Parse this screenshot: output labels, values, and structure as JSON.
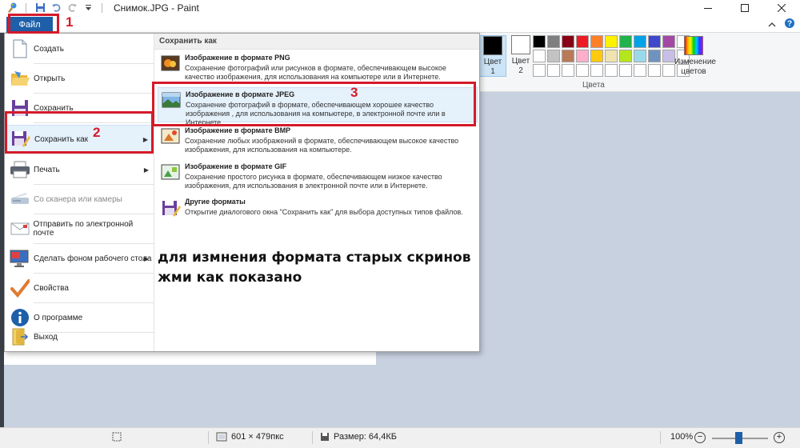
{
  "window": {
    "title": "Снимок.JPG - Paint"
  },
  "ribbon": {
    "file_tab_label": "Файл",
    "color1_label": "Цвет 1",
    "color2_label": "Цвет 2",
    "edit_colors_label": "Изменение цветов",
    "colors_group_label": "Цвета",
    "palette": [
      "#000000",
      "#7f7f7f",
      "#880015",
      "#ed1c24",
      "#ff7f27",
      "#fff200",
      "#22b14c",
      "#00a2e8",
      "#3f48cc",
      "#a349a4",
      "#ffffff",
      "#ffffff",
      "#c3c3c3",
      "#b97a57",
      "#ffaec9",
      "#ffc90e",
      "#efe4b0",
      "#b5e61d",
      "#99d9ea",
      "#7092be",
      "#c8bfe7",
      "#ffffff",
      "#ffffff",
      "#ffffff",
      "#ffffff",
      "#ffffff",
      "#ffffff",
      "#ffffff",
      "#ffffff",
      "#ffffff",
      "#ffffff",
      "#ffffff",
      "#ffffff"
    ],
    "color1_value": "#000000",
    "color2_value": "#ffffff"
  },
  "file_menu": {
    "items": [
      {
        "label": "Создать",
        "icon": "new-file-icon"
      },
      {
        "label": "Открыть",
        "icon": "open-folder-icon"
      },
      {
        "label": "Сохранить",
        "icon": "save-icon"
      },
      {
        "label": "Сохранить как",
        "icon": "save-as-icon",
        "has_submenu": true,
        "selected": true
      },
      {
        "label": "Печать",
        "icon": "printer-icon",
        "has_submenu": true
      },
      {
        "label": "Со сканера или камеры",
        "icon": "scanner-icon",
        "disabled": true
      },
      {
        "label": "Отправить по электронной почте",
        "icon": "email-icon"
      },
      {
        "label": "Сделать фоном рабочего стола",
        "icon": "desktop-background-icon",
        "has_submenu": true
      },
      {
        "label": "Свойства",
        "icon": "checkmark-icon"
      },
      {
        "label": "О программе",
        "icon": "info-icon"
      },
      {
        "label": "Выход",
        "icon": "exit-icon"
      }
    ]
  },
  "save_as_submenu": {
    "header": "Сохранить как",
    "items": [
      {
        "title": "Изображение в формате PNG",
        "description": "Сохранение фотографий или рисунков в формате, обеспечивающем высокое качество изображения, для использования на компьютере или в Интернете.",
        "icon": "png-image-icon"
      },
      {
        "title": "Изображение в формате JPEG",
        "description": "Сохранение фотографий в формате, обеспечивающем хорошее качество изображения , для использования на компьютере, в электронной почте или в Интернете.",
        "icon": "jpeg-image-icon",
        "selected": true
      },
      {
        "title": "Изображение в формате BMP",
        "description": "Сохранение любых изображений в формате, обеспечивающем высокое качество изображения, для использования на компьютере.",
        "icon": "bmp-image-icon"
      },
      {
        "title": "Изображение в формате GIF",
        "description": "Сохранение простого рисунка в формате, обеспечивающем низкое качество изображения, для использования в электронной почте или в Интернете.",
        "icon": "gif-image-icon"
      },
      {
        "title": "Другие форматы",
        "description": "Открытие диалогового окна \"Сохранить как\" для выбора доступных типов файлов.",
        "icon": "other-formats-icon"
      }
    ]
  },
  "annotation": {
    "text": "для измнения формата старых скринов жми как показано",
    "step1": "1",
    "step2": "2",
    "step3": "3",
    "color": "#d41a2a"
  },
  "statusbar": {
    "dimensions": "601 × 479пкс",
    "size": "Размер: 64,4КБ",
    "zoom": "100%"
  }
}
